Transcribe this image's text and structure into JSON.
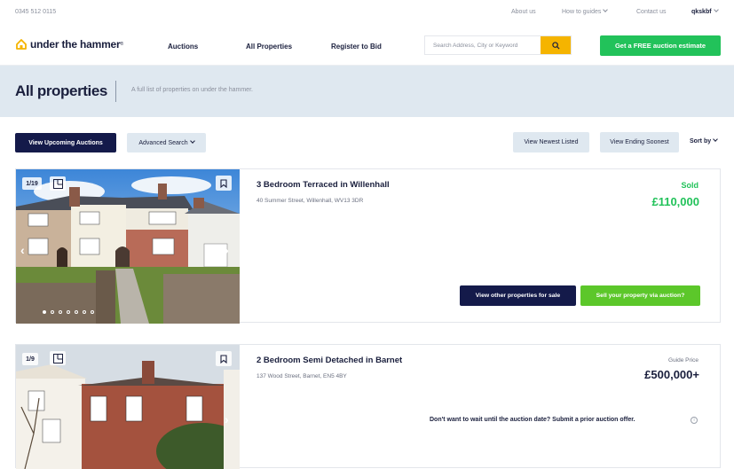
{
  "topbar": {
    "phone": "0345 512 0115",
    "links": [
      "About us",
      "How to guides",
      "Contact us"
    ],
    "user": "qkskbf"
  },
  "nav": {
    "logo_text": "under the hammer",
    "items": [
      "Auctions",
      "All Properties",
      "Register to Bid"
    ],
    "search_placeholder": "Search Address, City or Keyword",
    "cta": "Get a FREE auction estimate"
  },
  "hero": {
    "title": "All properties",
    "subtitle": "A full list of properties on under the hammer."
  },
  "toolbar": {
    "upcoming": "View Upcoming Auctions",
    "advanced": "Advanced Search",
    "newest": "View Newest Listed",
    "ending": "View Ending Soonest",
    "sort": "Sort by"
  },
  "listings": [
    {
      "counter": "1/19",
      "title": "3 Bedroom Terraced in Willenhall",
      "address": "40 Summer Street, Willenhall, WV13 3DR",
      "status": "Sold",
      "price": "£110,000",
      "btn_other": "View other properties for sale",
      "btn_sell": "Sell your property via auction?",
      "status_color": "#22c25a"
    },
    {
      "counter": "1/9",
      "title": "2 Bedroom Semi Detached in Barnet",
      "address": "137 Wood Street, Barnet, EN5 4BY",
      "guide_label": "Guide Price",
      "price": "£500,000+",
      "offer_text": "Don't want to wait until the auction date? Submit a prior auction offer."
    }
  ],
  "colors": {
    "navy": "#141a4a",
    "green": "#22c25a",
    "yellow": "#f5b400",
    "hero_bg": "#dfe8f0"
  }
}
